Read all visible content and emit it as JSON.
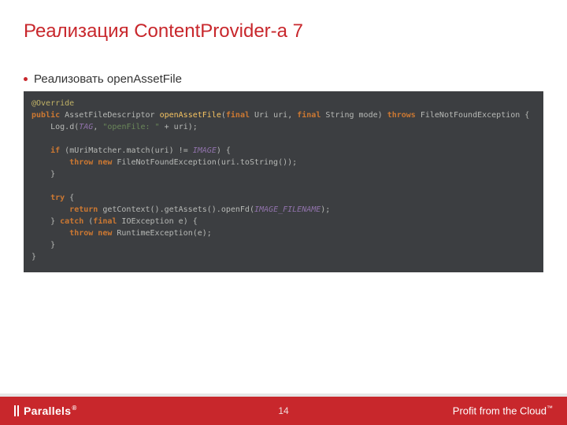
{
  "title": "Реализация ContentProvider-а 7",
  "bullet": "Реализовать openAssetFile",
  "code": {
    "l1": {
      "annotation": "@Override"
    },
    "l2": {
      "k1": "public",
      "type1": "AssetFileDescriptor",
      "method": "openAssetFile",
      "p_open": "(",
      "k2": "final",
      "type2": "Uri",
      "arg1": "uri",
      "comma": ", ",
      "k3": "final",
      "type3": "String",
      "arg2": "mode",
      "p_close": ")",
      "k4": "throws",
      "exc": "FileNotFoundException",
      "brace": " {"
    },
    "l3": {
      "pad": "    ",
      "obj": "Log",
      "dot": ".",
      "call": "d",
      "open": "(",
      "field": "TAG",
      "mid": ", ",
      "str": "\"openFile: \"",
      "plus": " + uri);"
    },
    "l4": {
      "pad": "    ",
      "k1": "if",
      "open": " (",
      "obj": "mUriMatcher",
      "call": ".match(uri) != ",
      "field": "IMAGE",
      "close": ") {"
    },
    "l5": {
      "pad": "        ",
      "k1": "throw new",
      "type": " FileNotFoundException(uri.toString());"
    },
    "l6": {
      "pad": "    ",
      "brace": "}"
    },
    "l7": {
      "pad": "    ",
      "k1": "try",
      "brace": " {"
    },
    "l8": {
      "pad": "        ",
      "k1": "return",
      "mid": " getContext().getAssets().openFd(",
      "field": "IMAGE_FILENAME",
      "close": ");"
    },
    "l9": {
      "pad": "    ",
      "brace1": "} ",
      "k1": "catch",
      "open": " (",
      "k2": "final",
      "type": " IOException e",
      "close": ") {"
    },
    "l10": {
      "pad": "        ",
      "k1": "throw new",
      "type": " RuntimeException(e);"
    },
    "l11": {
      "pad": "    ",
      "brace": "}"
    },
    "l12": {
      "brace": "}"
    }
  },
  "footer": {
    "brand": "Parallels",
    "reg": "®",
    "page": "14",
    "tagline": "Profit from the Cloud",
    "tm": "™"
  }
}
